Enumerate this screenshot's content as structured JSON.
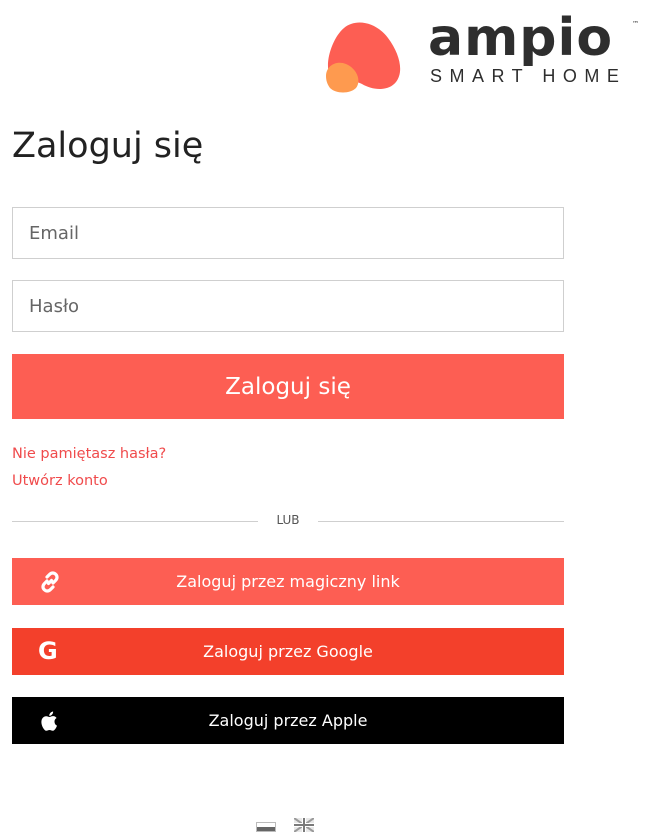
{
  "brand": {
    "name": "ampio",
    "tagline": "SMART HOME",
    "trademark": "™",
    "colors": {
      "orange": "#fe9a4f",
      "coral": "#fd5e53",
      "dark": "#2e2e2e"
    }
  },
  "login": {
    "title": "Zaloguj się",
    "email_placeholder": "Email",
    "password_placeholder": "Hasło",
    "submit_label": "Zaloguj się",
    "forgot_password": "Nie pamiętasz hasła?",
    "create_account": "Utwórz konto",
    "divider": "LUB"
  },
  "alt_login": {
    "magic_link": {
      "label": "Zaloguj przez magiczny link",
      "icon": "link-icon",
      "color": "#fd5e53"
    },
    "google": {
      "label": "Zaloguj przez Google",
      "icon": "google-icon",
      "letter": "G",
      "color": "#f3402b"
    },
    "apple": {
      "label": "Zaloguj przez Apple",
      "icon": "apple-icon",
      "color": "#000000"
    }
  },
  "languages": [
    {
      "icon": "flag-pl-icon"
    },
    {
      "icon": "flag-gb-icon"
    }
  ]
}
